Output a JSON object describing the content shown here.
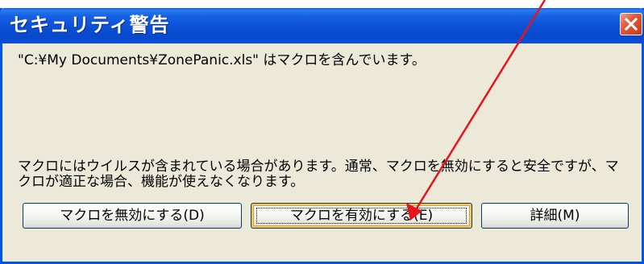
{
  "window": {
    "title": "セキュリティ警告",
    "close_icon": "close-icon"
  },
  "message": {
    "file_notice": "\"C:¥My Documents¥ZonePanic.xls\" はマクロを含んでいます。",
    "warning": "マクロにはウイルスが含まれている場合があります。通常、マクロを無効にすると安全ですが、マクロが適正な場合、機能が使えなくなります。"
  },
  "buttons": {
    "disable": "マクロを無効にする(D)",
    "enable": "マクロを有効にする(E)",
    "details": "詳細(M)"
  },
  "annotation": {
    "arrow_color": "#e8141b",
    "arrow_icon": "arrow-annotation"
  },
  "colors": {
    "titlebar": "#0a50d4",
    "dialog_face": "#ece9d8",
    "close_button": "#e05a3a"
  }
}
